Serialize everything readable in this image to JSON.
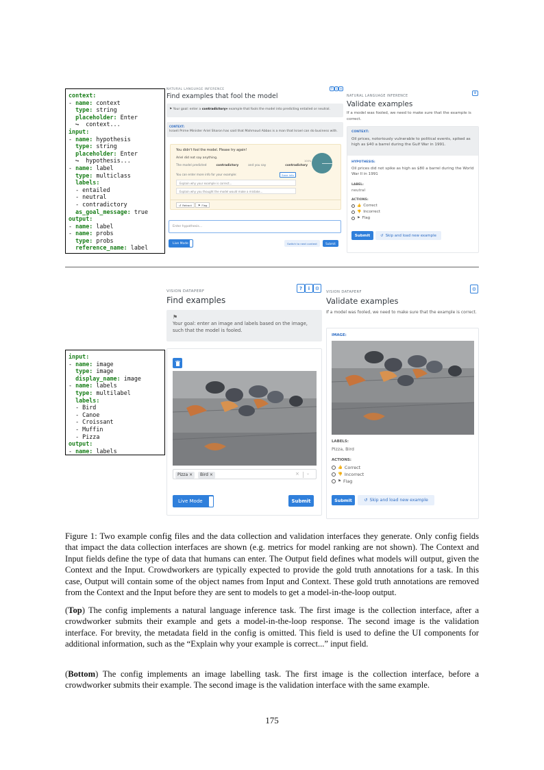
{
  "top": {
    "config_lines": [
      [
        "context:"
      ],
      [
        "- name:",
        " context"
      ],
      [
        "  type:",
        " string"
      ],
      [
        "  placeholder:",
        " Enter"
      ],
      [
        "  ↪  context..."
      ],
      [
        "input:"
      ],
      [
        "- name:",
        " hypothesis"
      ],
      [
        "  type:",
        " string"
      ],
      [
        "  placeholder:",
        " Enter"
      ],
      [
        "  ↪  hypothesis..."
      ],
      [
        "- name:",
        " label"
      ],
      [
        "  type:",
        " multiclass"
      ],
      [
        "  labels:"
      ],
      [
        "  - entailed"
      ],
      [
        "  - neutral"
      ],
      [
        "  - contradictory"
      ],
      [
        "  as_goal_message:",
        " true"
      ],
      [
        "output:"
      ],
      [
        "- name:",
        " label"
      ],
      [
        "- name:",
        " probs"
      ],
      [
        "  type:",
        " probs"
      ],
      [
        "  reference_name:",
        " label"
      ]
    ],
    "collection": {
      "caption": "NATURAL LANGUAGE INFERENCE",
      "title": "Find examples that fool the model",
      "goal_prefix": "Your goal: enter a",
      "goal_label": "contradictory",
      "goal_suffix": "example that fools the model into predicting entailed or neutral.",
      "context_heading": "CONTEXT:",
      "context_text": "Israeli Prime Minister Ariel Sharon has said that Mahmoud Abbas is a man that Israel can do business with.",
      "fail_msg": "You didn't fool the model. Please try again!",
      "hypothesis_text": "Ariel did not say anything.",
      "model_predicted": "The model predicted",
      "predicted_label": "contradictory",
      "and_you_say": "and you say",
      "your_label": "contradictory",
      "more_info": "You can enter more info for your example:",
      "save_info": "Save info",
      "explain_correct": "Explain why your example is correct...",
      "explain_wrong": "Explain why you thought the model would make a mistake...",
      "retract": "Retract",
      "flag": "Flag",
      "pie_label": "100%",
      "hypothesis_placeholder": "Enter hypothesis...",
      "live_mode": "Live Mode",
      "switch_context": "Switch to next context",
      "submit": "Submit",
      "icons": [
        "?",
        "i",
        "⚙"
      ]
    },
    "validation": {
      "caption": "NATURAL LANGUAGE INFERENCE",
      "title": "Validate examples",
      "intro": "If a model was fooled, we need to make sure that the example is correct.",
      "context_heading": "CONTEXT:",
      "context_text": "Oil prices, notoriously vulnerable to political events, spiked as high as $40 a barrel during the Gulf War in 1991.",
      "hypothesis_heading": "HYPOTHESIS:",
      "hypothesis_text": "Oil prices did not spike as high as $80 a barrel during the World War II in 1991",
      "label_heading": "LABEL:",
      "label_value": "neutral",
      "actions_heading": "ACTIONS:",
      "actions": [
        "Correct",
        "Incorrect",
        "Flag"
      ],
      "submit": "Submit",
      "skip": "Skip and load new example"
    }
  },
  "bottom": {
    "config_lines": [
      [
        "input:"
      ],
      [
        "- name:",
        " image"
      ],
      [
        "  type:",
        " image"
      ],
      [
        "  display_name:",
        " image"
      ],
      [
        "- name:",
        " labels"
      ],
      [
        "  type:",
        " multilabel"
      ],
      [
        "  labels:"
      ],
      [
        "  - Bird"
      ],
      [
        "  - Canoe"
      ],
      [
        "  - Croissant"
      ],
      [
        "  - Muffin"
      ],
      [
        "  - Pizza"
      ],
      [
        "output:"
      ],
      [
        "- name:",
        " labels"
      ]
    ],
    "collection": {
      "caption": "VISION DATAPERF",
      "title": "Find examples",
      "goal": "Your goal: enter an image and labels based on the image, such that the model is fooled.",
      "tags": [
        "Pizza",
        "Bird"
      ],
      "live_mode": "Live Mode",
      "submit": "Submit",
      "icons": [
        "?",
        "i",
        "⚙"
      ]
    },
    "validation": {
      "caption": "VISION DATAPERF",
      "title": "Validate examples",
      "intro": "If a model was fooled, we need to make sure that the example is correct.",
      "image_heading": "IMAGE:",
      "labels_heading": "LABELS:",
      "labels_value": "Pizza, Bird",
      "actions_heading": "ACTIONS:",
      "actions": [
        "Correct",
        "Incorrect",
        "Flag"
      ],
      "submit": "Submit",
      "skip": "Skip and load new example"
    }
  },
  "caption": {
    "figure": "Figure 1: Two example config files and the data collection and validation interfaces they generate. Only config fields that impact the data collection interfaces are shown (e.g. metrics for model ranking are not shown). The Context and Input fields define the type of data that humans can enter. The Output field defines what models will output, given the Context and the Input. Crowdworkers are typically expected to provide the gold truth annotations for a task. In this case, Output will contain some of the object names from Input and Context. These gold truth annotations are removed from the Context and the Input before they are sent to models to get a model-in-the-loop output.",
    "top_label": "Top",
    "top_text": " The config implements a natural language inference task.  The first image is the collection interface, after a crowdworker submits their example and gets a model-in-the-loop response.  The second image is the validation interface. For brevity, the metadata field in the config is omitted. This field is used to define the UI components for additional information, such as the “Explain why your example is correct...” input field.",
    "bottom_label": "Bottom",
    "bottom_text": " The config implements an image labelling task.  The first image is the collection interface, before a crowdworker submits their example. The second image is the validation interface with the same example."
  },
  "page_number": "175"
}
